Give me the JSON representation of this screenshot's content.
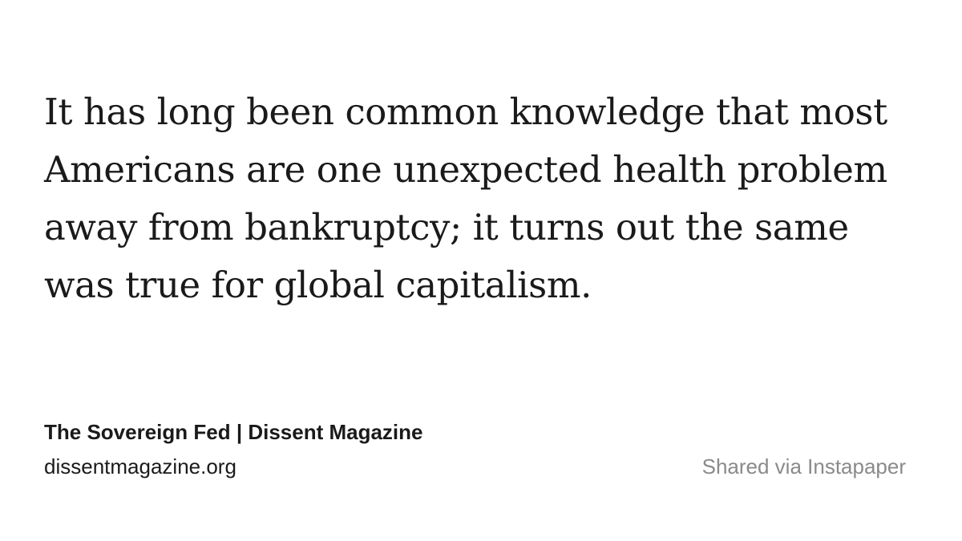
{
  "quote": {
    "lines": [
      "It has long been common knowledge that most",
      "Americans are one unexpected health problem",
      "away from bankruptcy; it turns out the same",
      "was true for global capitalism."
    ]
  },
  "source": {
    "title": "The Sovereign Fed | Dissent Magazine",
    "domain": "dissentmagazine.org"
  },
  "footer": {
    "shared_via": "Shared via Instapaper"
  },
  "colors": {
    "background": "#ffffff",
    "text": "#1a1a1a",
    "muted": "#8a8a8a"
  }
}
